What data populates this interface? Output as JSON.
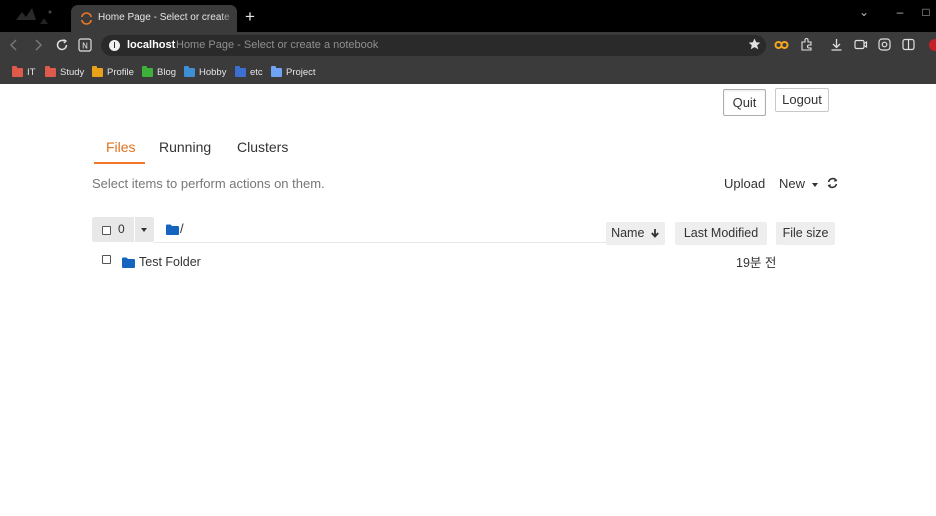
{
  "browser": {
    "tab_title": "Home Page - Select or create a notebook",
    "new_tab_label": "+",
    "address_host": "localhost",
    "address_rest": "Home Page - Select or create a notebook",
    "bookmarks": [
      {
        "label": "IT",
        "color": "#e05a4b"
      },
      {
        "label": "Study",
        "color": "#e05a4b"
      },
      {
        "label": "Profile",
        "color": "#e8a21a"
      },
      {
        "label": "Blog",
        "color": "#3db13a"
      },
      {
        "label": "Hobby",
        "color": "#3f8fd6"
      },
      {
        "label": "etc",
        "color": "#3c6fd0"
      },
      {
        "label": "Project",
        "color": "#6fa3f5"
      }
    ]
  },
  "header": {
    "quit_label": "Quit",
    "logout_label": "Logout"
  },
  "tabs": [
    {
      "label": "Files",
      "active": true
    },
    {
      "label": "Running",
      "active": false
    },
    {
      "label": "Clusters",
      "active": false
    }
  ],
  "files": {
    "hint": "Select items to perform actions on them.",
    "upload_label": "Upload",
    "new_label": "New",
    "selected_count": "0",
    "breadcrumb": "/",
    "columns": {
      "name": "Name",
      "last_modified": "Last Modified",
      "file_size": "File size"
    },
    "items": [
      {
        "name": "Test Folder",
        "last_modified": "19분 전",
        "type": "folder"
      }
    ]
  },
  "colors": {
    "accent": "#f37726",
    "folder": "#1565c0",
    "browser_bg": "#3b3b3b"
  }
}
